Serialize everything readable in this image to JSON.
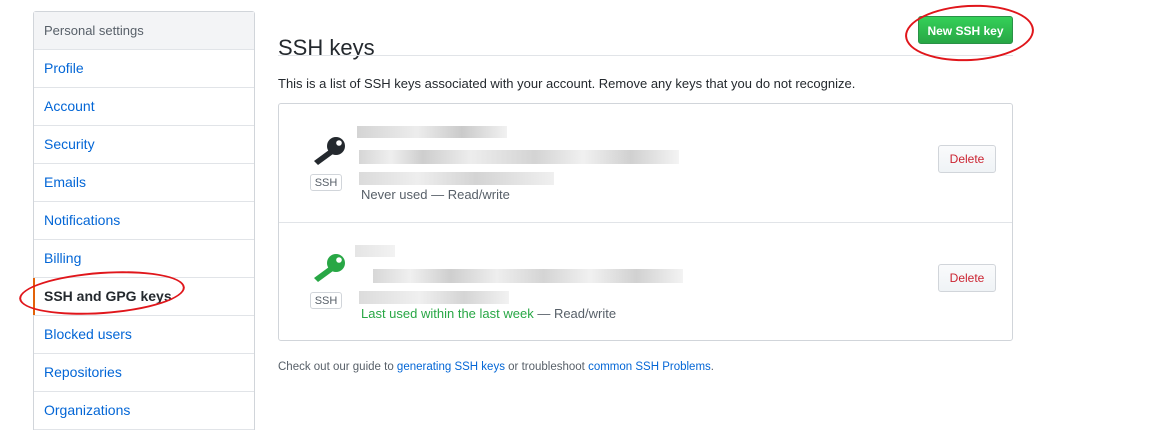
{
  "sidebar": {
    "header": "Personal settings",
    "items": [
      {
        "label": "Profile",
        "selected": false
      },
      {
        "label": "Account",
        "selected": false
      },
      {
        "label": "Security",
        "selected": false
      },
      {
        "label": "Emails",
        "selected": false
      },
      {
        "label": "Notifications",
        "selected": false
      },
      {
        "label": "Billing",
        "selected": false
      },
      {
        "label": "SSH and GPG keys",
        "selected": true
      },
      {
        "label": "Blocked users",
        "selected": false
      },
      {
        "label": "Repositories",
        "selected": false
      },
      {
        "label": "Organizations",
        "selected": false
      }
    ]
  },
  "main": {
    "title": "SSH keys",
    "new_key_button": "New SSH key",
    "description": "This is a list of SSH keys associated with your account. Remove any keys that you do not recognize.",
    "keys": [
      {
        "type_badge": "SSH",
        "usage_main": "Never used",
        "usage_recent": "",
        "usage_suffix": " — Read/write",
        "icon_color": "#24292e",
        "delete_label": "Delete"
      },
      {
        "type_badge": "SSH",
        "usage_main": "",
        "usage_recent": "Last used within the last week",
        "usage_suffix": " — Read/write",
        "icon_color": "#28a745",
        "delete_label": "Delete"
      }
    ],
    "footer": {
      "prefix": "Check out our guide to ",
      "link1": "generating SSH keys",
      "middle": " or troubleshoot ",
      "link2": "common SSH Problems",
      "suffix": "."
    }
  },
  "colors": {
    "primary_button": "#28a745",
    "link": "#0366d6",
    "danger": "#cb2431",
    "selected_marker": "#e36209",
    "annotation": "#e0161b"
  }
}
